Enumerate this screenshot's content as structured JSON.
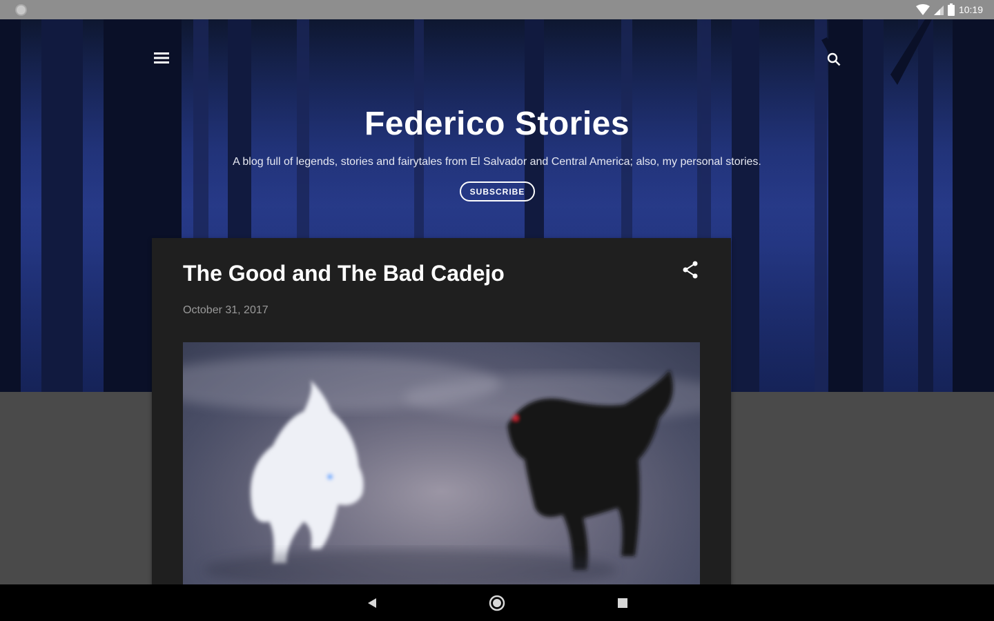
{
  "status_bar": {
    "time": "10:19",
    "icons": [
      "app-notification-icon",
      "wifi-icon",
      "cell-signal-icon",
      "battery-icon"
    ]
  },
  "header": {
    "menu_icon": "hamburger-menu-icon",
    "search_icon": "search-icon",
    "title": "Federico Stories",
    "description": "A blog full of legends, stories and fairytales from El Salvador and Central America; also, my personal stories.",
    "subscribe_label": "SUBSCRIBE"
  },
  "post": {
    "title": "The Good and The Bad Cadejo",
    "date": "October 31, 2017",
    "share_icon": "share-icon",
    "image_alt": "Illustration of a white and a black cadejo dog facing each other in mist"
  },
  "nav_bar": {
    "icons": [
      "back-icon",
      "home-icon",
      "recents-icon"
    ]
  },
  "colors": {
    "hero_blue": "#1d2e72",
    "card_bg": "#1f1f1f",
    "page_bg": "#4a4a4a",
    "status_bar": "#8e8e8e"
  }
}
